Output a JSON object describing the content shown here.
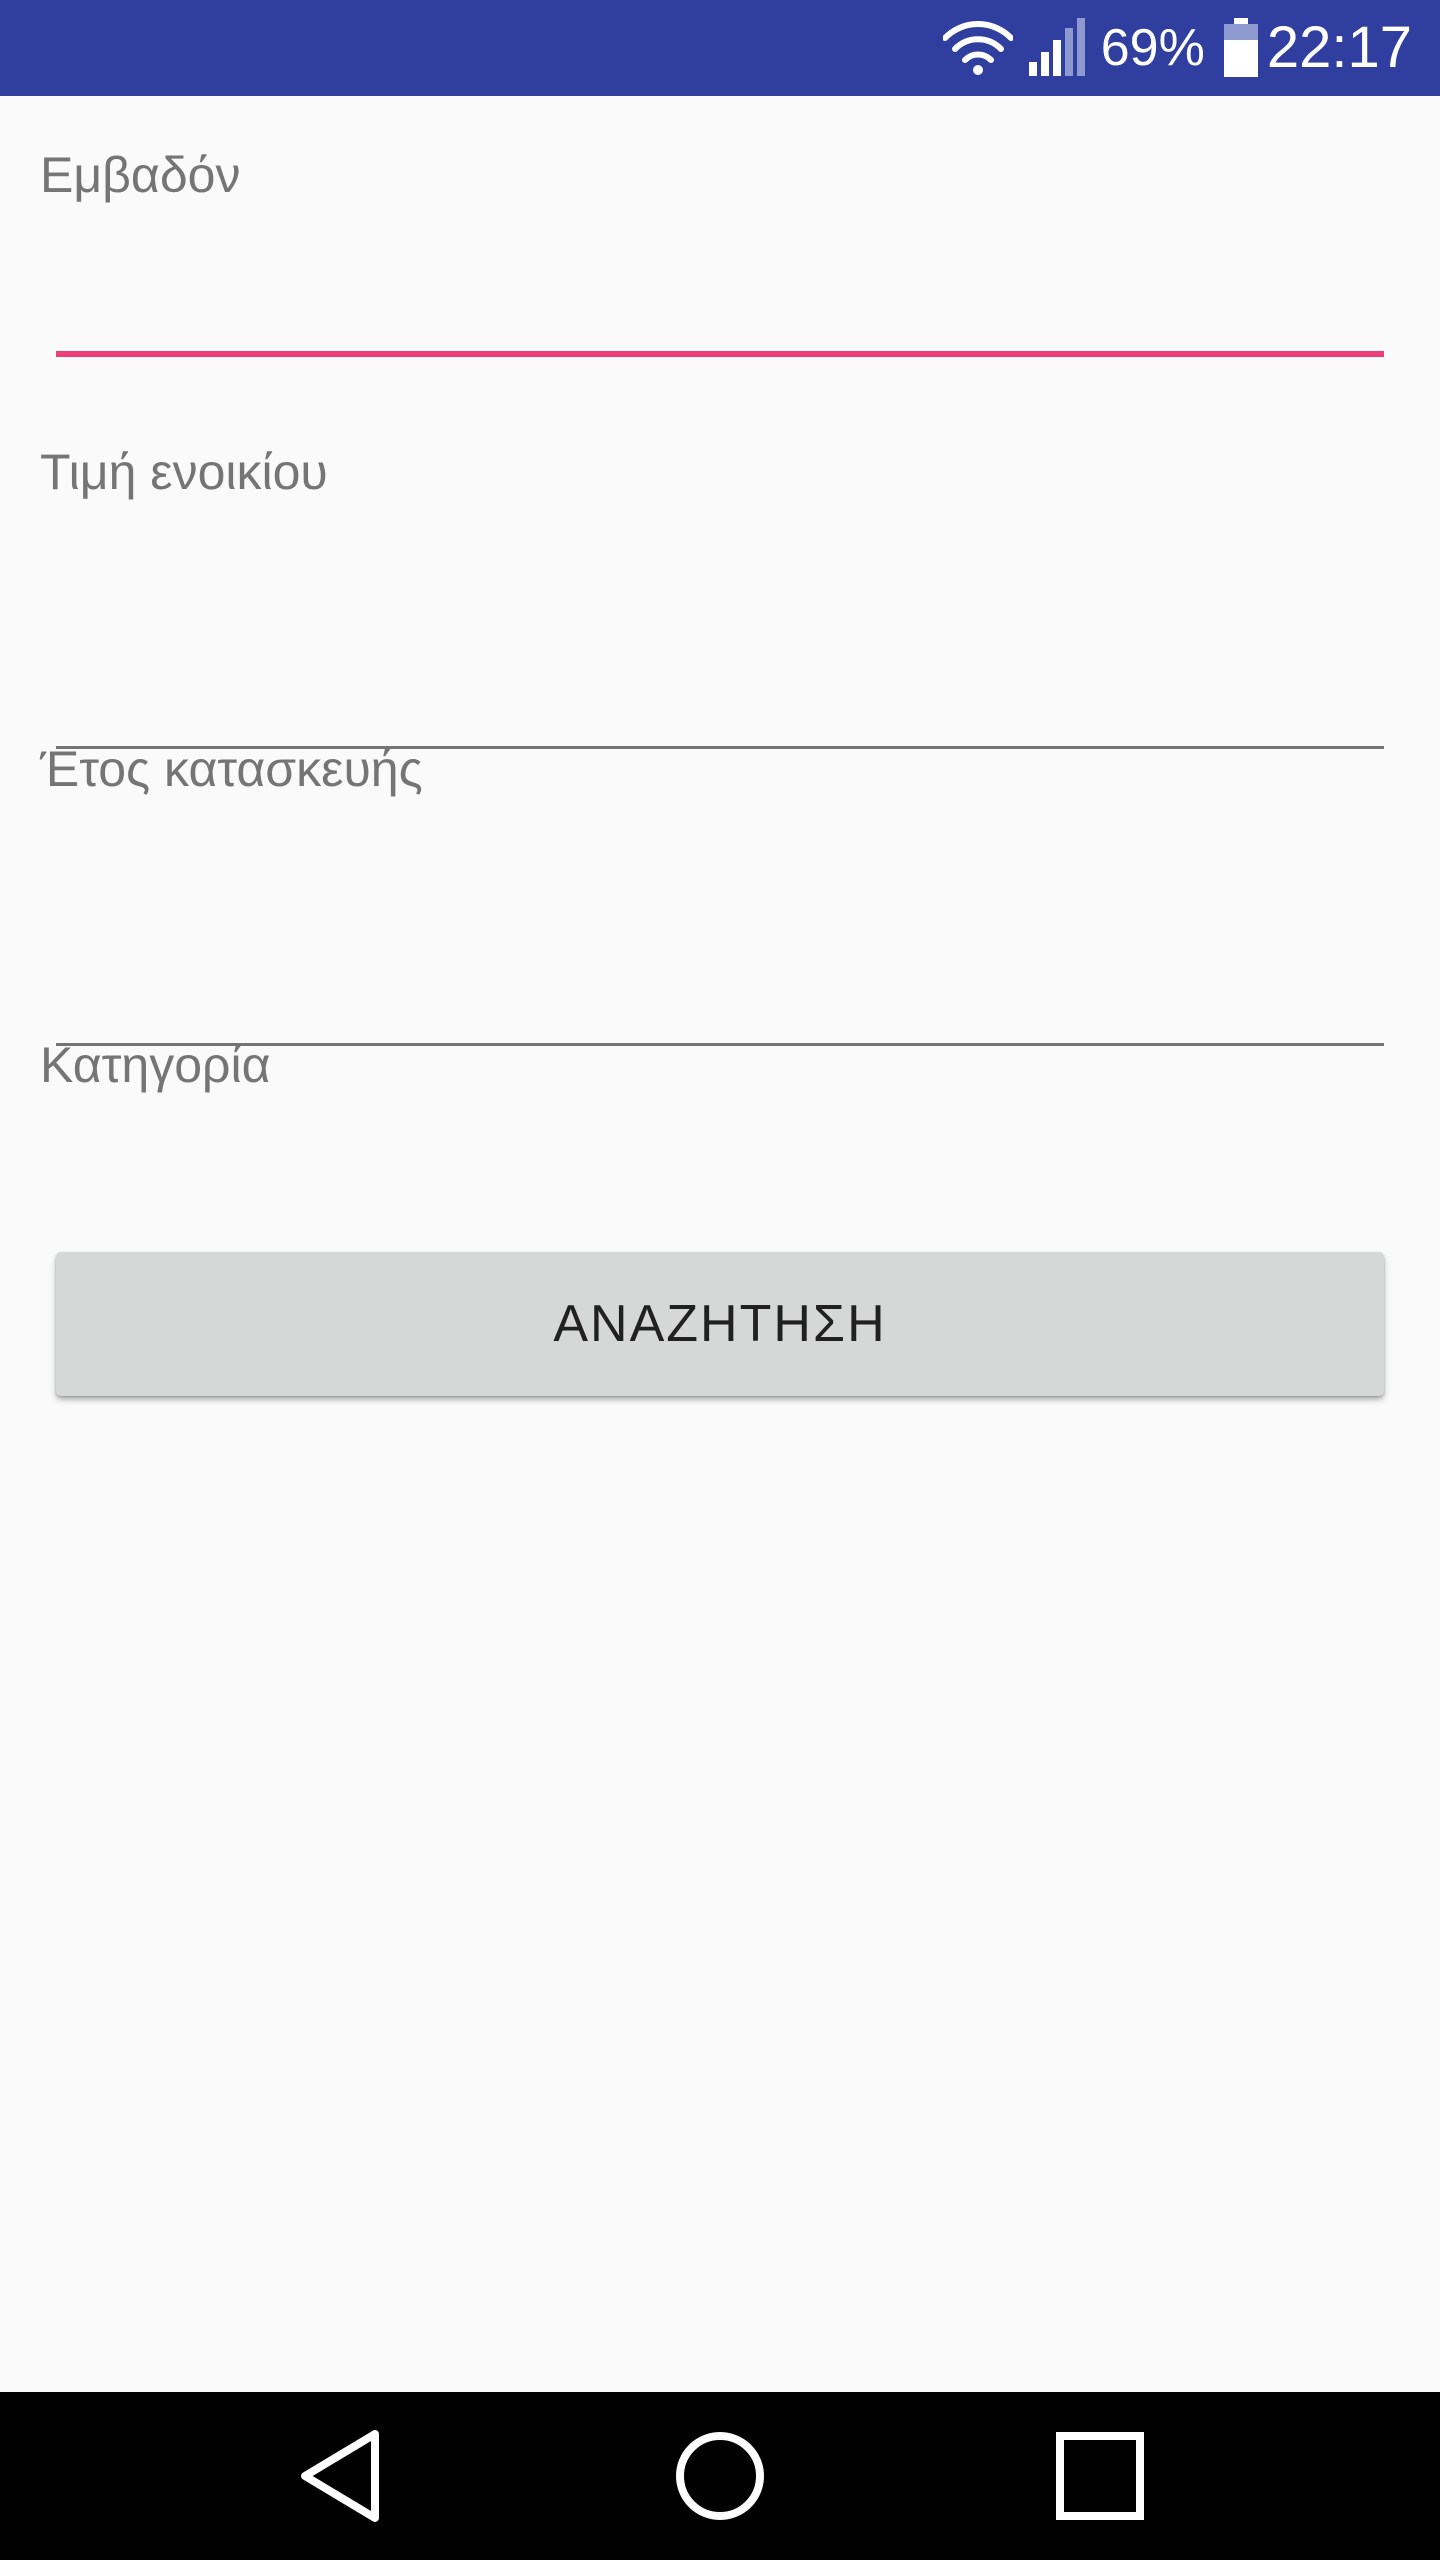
{
  "status_bar": {
    "battery_percent": "69%",
    "time": "22:17",
    "icons": [
      "wifi-icon",
      "signal-icon",
      "battery-icon"
    ],
    "color": "#303f9f"
  },
  "form": {
    "fields": [
      {
        "label": "Εμβαδόν",
        "value": "",
        "focused": true
      },
      {
        "label": "Τιμή ενοικίου",
        "value": "",
        "focused": false
      },
      {
        "label": "Έτος κατασκευής",
        "value": "",
        "focused": false
      },
      {
        "label": "Κατηγορία",
        "value": "",
        "focused": false
      }
    ],
    "accent_color": "#ec407a"
  },
  "search_button": {
    "label": "ΑΝΑΖΗΤΗΣΗ"
  },
  "nav_bar": {
    "icons": [
      "back-icon",
      "home-icon",
      "recents-icon"
    ]
  }
}
